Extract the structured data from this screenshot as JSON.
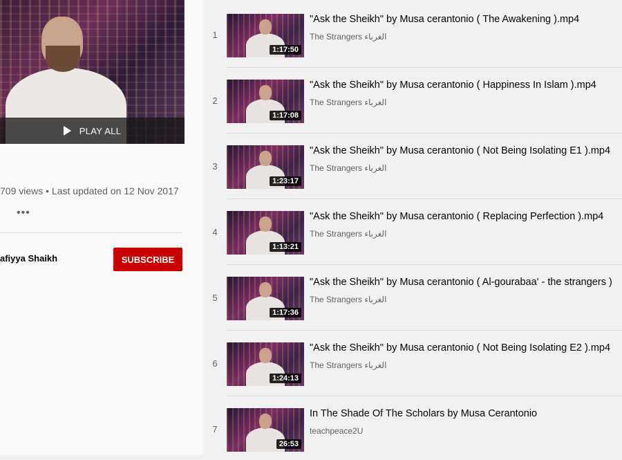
{
  "sidebar": {
    "play_all_label": "PLAY ALL",
    "stats": "709 views • Last updated on 12 Nov 2017",
    "more_label": "•••",
    "owner": "afiyya Shaikh",
    "subscribe_label": "SUBSCRIBE"
  },
  "playlist": [
    {
      "index": "1",
      "title": "\"Ask the Sheikh\" by Musa cerantonio ( The Awakening ).mp4",
      "channel": "The Strangers الغرباء",
      "duration": "1:17:50"
    },
    {
      "index": "2",
      "title": "\"Ask the Sheikh\" by Musa cerantonio ( Happiness In Islam ).mp4",
      "channel": "The Strangers الغرباء",
      "duration": "1:17:08"
    },
    {
      "index": "3",
      "title": "\"Ask the Sheikh\" by Musa cerantonio ( Not Being Isolating E1 ).mp4",
      "channel": "The Strangers الغرباء",
      "duration": "1:23:17"
    },
    {
      "index": "4",
      "title": "\"Ask the Sheikh\" by Musa cerantonio ( Replacing Perfection ).mp4",
      "channel": "The Strangers الغرباء",
      "duration": "1:13:21"
    },
    {
      "index": "5",
      "title": "\"Ask the Sheikh\" by Musa cerantonio ( Al-gourabaa' - the strangers )",
      "channel": "The Strangers الغرباء",
      "duration": "1:17:36"
    },
    {
      "index": "6",
      "title": "\"Ask the Sheikh\" by Musa cerantonio ( Not Being Isolating E2 ).mp4",
      "channel": "The Strangers الغرباء",
      "duration": "1:24:13"
    },
    {
      "index": "7",
      "title": "In The Shade Of The Scholars by Musa Cerantonio",
      "channel": "teachpeace2U",
      "duration": "26:53"
    }
  ],
  "colors": {
    "subscribe": "#cc0000",
    "meta_text": "#606060",
    "title_text": "#030303"
  },
  "icons": {
    "play_all": "play-icon",
    "more": "more-horiz-icon"
  }
}
